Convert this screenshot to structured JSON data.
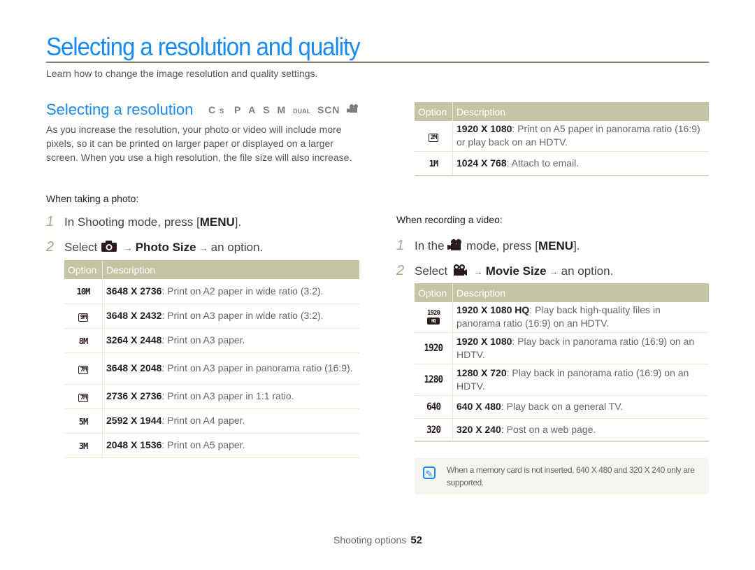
{
  "header": {
    "title": "Selecting a resolution and quality",
    "subtitle": "Learn how to change the image resolution and quality settings."
  },
  "section": {
    "title": "Selecting a resolution",
    "mode_icons": [
      "smart-auto",
      "P",
      "A",
      "S",
      "M",
      "DUAL",
      "SCN",
      "movie"
    ],
    "mode_labels": {
      "smart": "C",
      "smart_sub": "S",
      "p": "P",
      "a": "A",
      "s": "S",
      "m": "M",
      "dual": "DUAL",
      "scn": "SCN"
    },
    "intro": "As you increase the resolution, your photo or video will include more pixels, so it can be printed on larger paper or displayed on a larger screen. When you use a high resolution, the file size will also increase."
  },
  "photo": {
    "subhead": "When taking a photo:",
    "step1": {
      "num": "1",
      "prefix": "In Shooting mode, press [",
      "key": "MENU",
      "suffix": "]."
    },
    "step2": {
      "num": "2",
      "prefix": "Select",
      "arrow": "→",
      "menu": "Photo Size",
      "suffix": "an option."
    },
    "table": {
      "headers": [
        "Option",
        "Description"
      ],
      "rows": [
        {
          "icon": "10M",
          "res": "3648 X 2736",
          "desc": ": Print on A2 paper in wide ratio (3:2)."
        },
        {
          "icon": "9M",
          "res": "3648 X 2432",
          "desc": ": Print on A3 paper in wide ratio (3:2)."
        },
        {
          "icon": "8M",
          "res": "3264 X 2448",
          "desc": ": Print on A3 paper."
        },
        {
          "icon": "7M",
          "res": "3648 X 2048",
          "desc": ": Print on A3 paper in panorama ratio (16:9)."
        },
        {
          "icon": "7M",
          "res": "2736 X 2736",
          "desc": ": Print on A3 paper in 1:1 ratio."
        },
        {
          "icon": "5M",
          "res": "2592 X 1944",
          "desc": ": Print on A4 paper."
        },
        {
          "icon": "3M",
          "res": "2048 X 1536",
          "desc": ": Print on A5 paper."
        }
      ]
    }
  },
  "photo_cont": {
    "table": {
      "headers": [
        "Option",
        "Description"
      ],
      "rows": [
        {
          "icon": "2M",
          "res": "1920 X 1080",
          "desc": ": Print on A5 paper in panorama ratio (16:9) or play back on an HDTV."
        },
        {
          "icon": "1M",
          "res": "1024 X 768",
          "desc": ": Attach to email."
        }
      ]
    }
  },
  "video": {
    "subhead": "When recording a video:",
    "step1": {
      "num": "1",
      "prefix": "In the",
      "middle": "mode, press [",
      "key": "MENU",
      "suffix": "]."
    },
    "step2": {
      "num": "2",
      "prefix": "Select",
      "arrow": "→",
      "menu": "Movie Size",
      "suffix": "an option."
    },
    "table": {
      "headers": [
        "Option",
        "Description"
      ],
      "rows": [
        {
          "icon": "1920",
          "badge": "HQ",
          "res": "1920 X 1080 HQ",
          "desc": ": Play back high-quality files in panorama ratio (16:9) on an HDTV."
        },
        {
          "icon": "1920",
          "res": "1920 X 1080",
          "desc": ": Play back in panorama ratio (16:9) on an HDTV."
        },
        {
          "icon": "1280",
          "res": "1280 X 720",
          "desc": ": Play back in panorama ratio (16:9) on an HDTV."
        },
        {
          "icon": "640",
          "res": "640 X 480",
          "desc": ": Play back on a general TV."
        },
        {
          "icon": "320",
          "res": "320 X 240",
          "desc": ": Post on a web page."
        }
      ]
    }
  },
  "note": {
    "icon": "note-icon",
    "text": "When a memory card is not inserted, 640 X 480 and 320 X 240 only are supported."
  },
  "footer": {
    "section": "Shooting options",
    "page": "52"
  },
  "colors": {
    "accent": "#1a8af0",
    "table_header": "#c5c5a6",
    "step_number": "#a0a98a",
    "note_bg": "#f5f4ef"
  }
}
